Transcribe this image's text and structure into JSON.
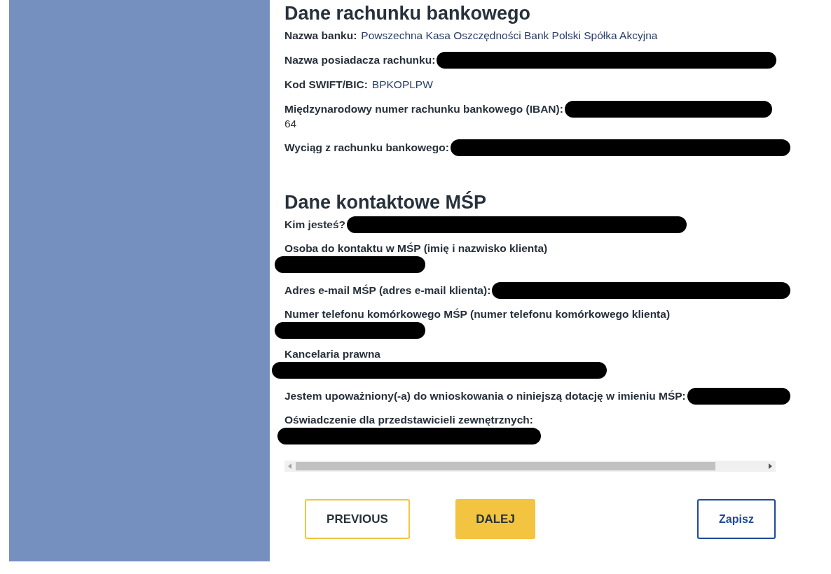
{
  "sections": [
    {
      "title": "Dane rachunku bankowego",
      "fields": [
        {
          "label": "Nazwa banku:",
          "value": "Powszechna Kasa Oszczędności Bank Polski Spółka Akcyjna",
          "kind": "inline",
          "redacted": false
        },
        {
          "label": "Nazwa posiadacza rachunku:",
          "kind": "inline",
          "redacted": true
        },
        {
          "label": "Kod SWIFT/BIC:",
          "value": "BPKOPLPW",
          "kind": "inline",
          "redacted": false
        },
        {
          "label": "Międzynarodowy numer rachunku bankowego (IBAN):",
          "value": "64",
          "kind": "wrap",
          "redacted": true
        },
        {
          "label": "Wyciąg z rachunku bankowego:",
          "kind": "inline",
          "redacted": true
        }
      ]
    },
    {
      "title": "Dane kontaktowe MŚP",
      "fields": [
        {
          "label": "Kim jesteś?",
          "kind": "inline",
          "redacted": true
        },
        {
          "label": "Osoba do kontaktu w MŚP (imię i nazwisko klienta)",
          "kind": "below",
          "redacted": true
        },
        {
          "label": "Adres e-mail MŚP (adres e-mail klienta):",
          "kind": "inline",
          "redacted": true
        },
        {
          "label": "Numer telefonu komórkowego MŚP (numer telefonu komórkowego klienta)",
          "kind": "below",
          "redacted": true
        },
        {
          "label": "Kancelaria prawna",
          "kind": "belowwide",
          "redacted": true
        },
        {
          "label": "Jestem upoważniony(-a) do wnioskowania o niniejszą dotację w imieniu MŚP:",
          "kind": "inline",
          "redacted": true
        },
        {
          "label": "Oświadczenie dla przedstawicieli zewnętrznych:",
          "kind": "belowmid",
          "redacted": true
        }
      ]
    }
  ],
  "buttons": [
    {
      "label": "PREVIOUS",
      "kind": "secondary"
    },
    {
      "label": "DALEJ",
      "kind": "primary"
    },
    {
      "label": "Zapisz",
      "kind": "save"
    }
  ]
}
